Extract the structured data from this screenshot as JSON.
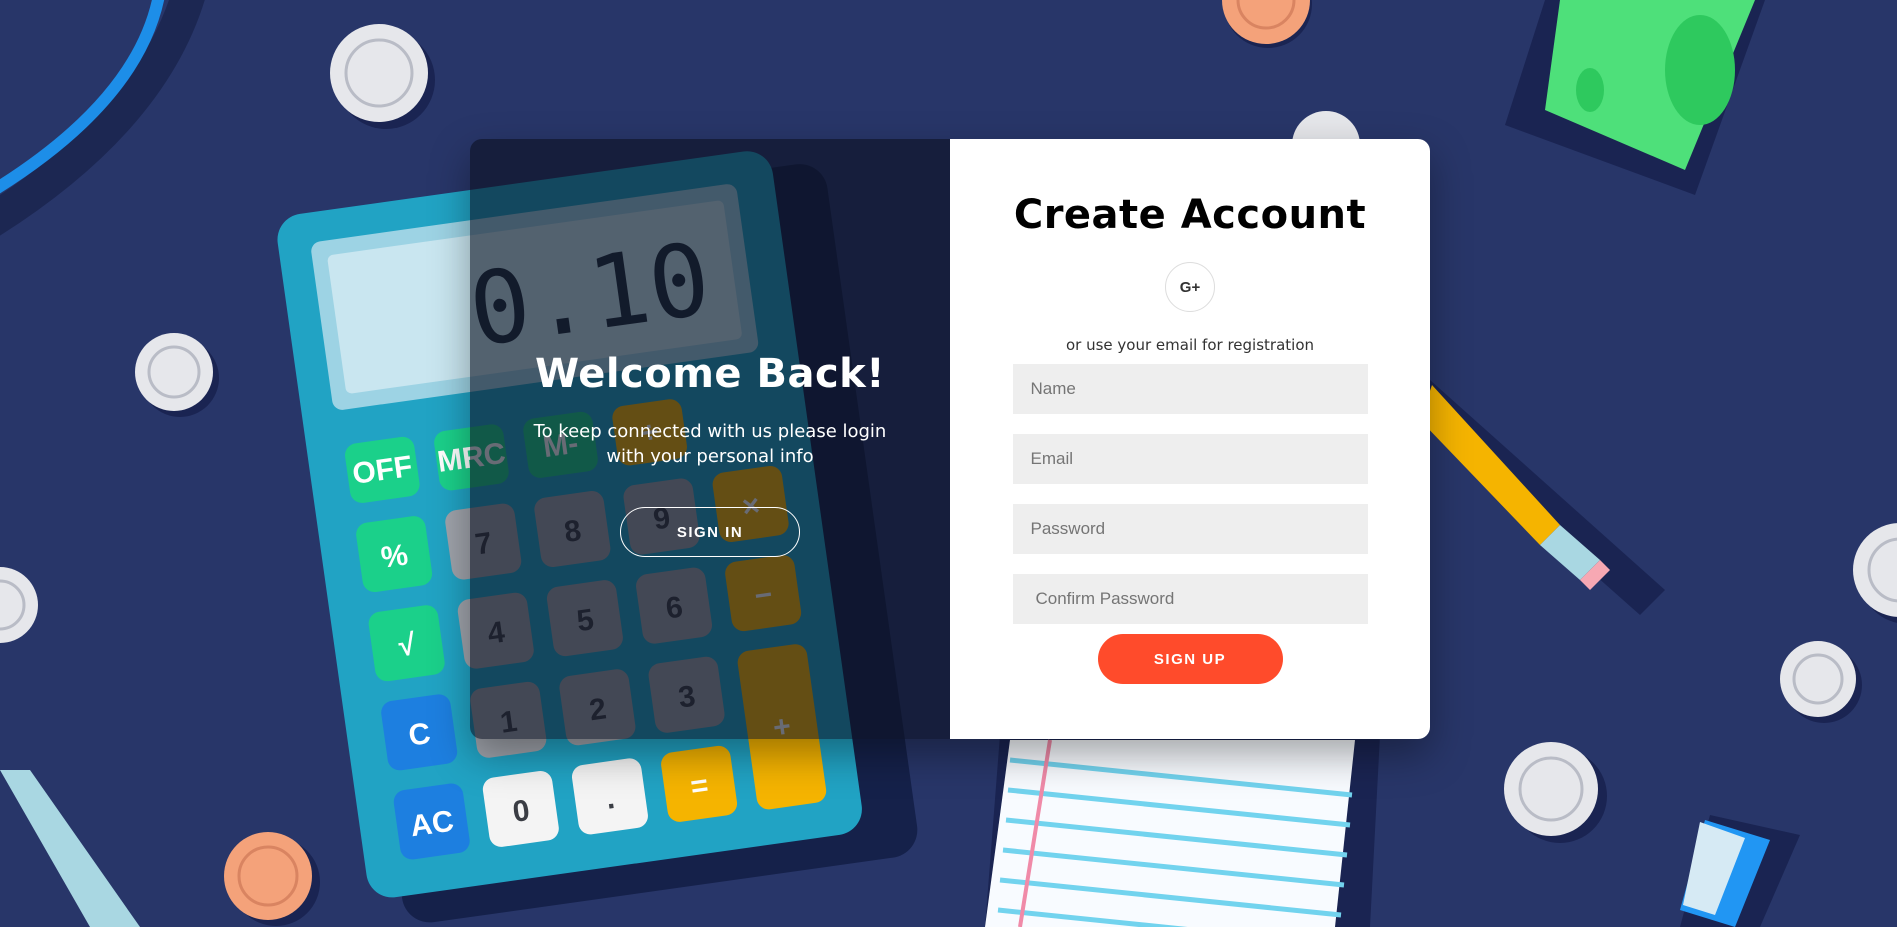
{
  "overlay": {
    "title": "Welcome Back!",
    "text": "To keep connected with us please login with your personal info",
    "signin_label": "SIGN IN"
  },
  "form": {
    "title": "Create Account",
    "social_label": "G+",
    "or_text": "or use your email for registration",
    "name_placeholder": "Name",
    "email_placeholder": "Email",
    "password_placeholder": "Password",
    "confirm_placeholder": "Confirm Password",
    "signup_label": "SIGN UP"
  },
  "background": {
    "calculator_display": "0.10",
    "keys": [
      "OFF",
      "MRC",
      "M-",
      "÷",
      "%",
      "7",
      "8",
      "9",
      "×",
      "√",
      "4",
      "5",
      "6",
      "−",
      "C",
      "1",
      "2",
      "3",
      "+",
      "AC",
      "0",
      ".",
      "="
    ]
  },
  "colors": {
    "background": "#283669",
    "accent": "#ff4b2b",
    "input_bg": "#eeeeee"
  }
}
